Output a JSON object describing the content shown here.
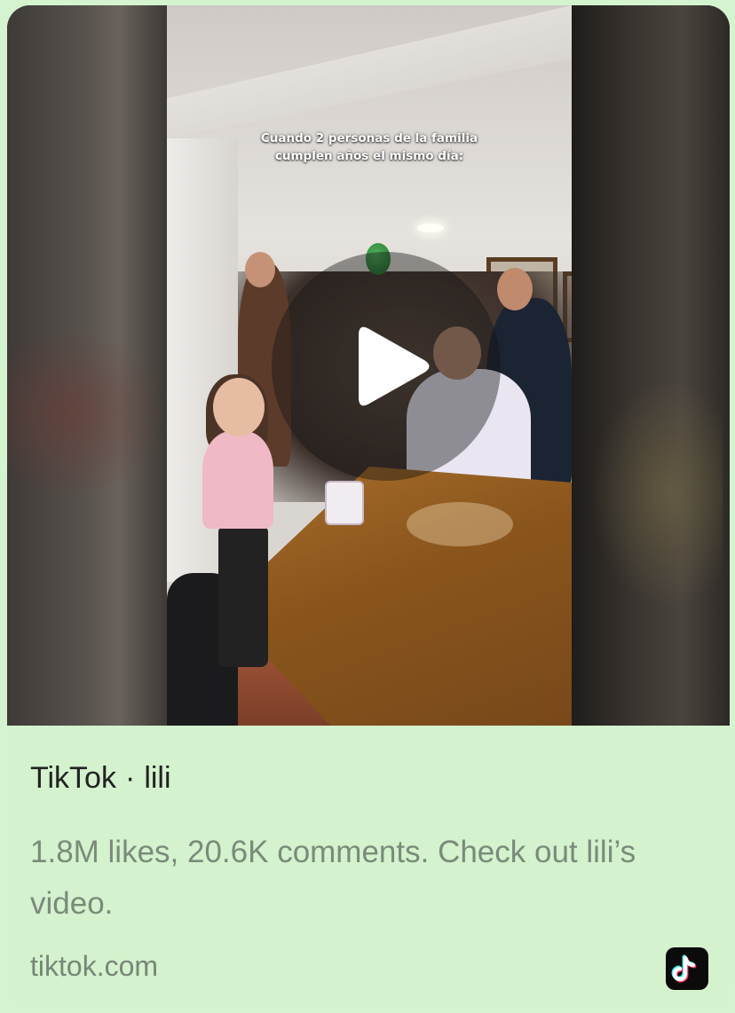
{
  "video": {
    "caption_line1": "Cuando 2 personas de la familia",
    "caption_line2": "cumplen años el mismo día:"
  },
  "card": {
    "source": "TikTok",
    "separator": "·",
    "author": "lili",
    "description": "1.8M likes, 20.6K comments. Check out lili’s video.",
    "domain": "tiktok.com"
  },
  "icons": {
    "play": "play-icon",
    "brand": "tiktok-logo-icon"
  },
  "colors": {
    "background": "#d4f4cf",
    "title": "#222222",
    "description": "#7b8a7b",
    "domain": "#788678",
    "tiktok_cyan": "#25f4ee",
    "tiktok_red": "#fe2c55"
  }
}
